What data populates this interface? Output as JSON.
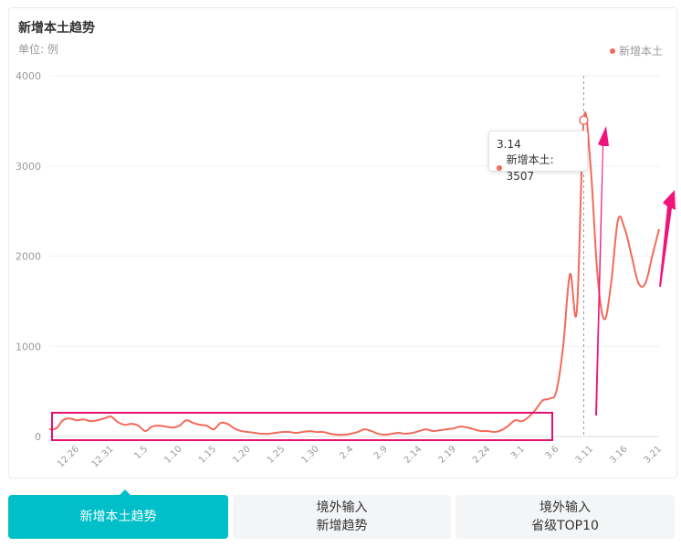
{
  "card": {
    "title": "新增本土趋势",
    "unit": "单位: 例",
    "legend_label": "新增本土"
  },
  "tooltip": {
    "date": "3.14",
    "label": "新增本土: 3507"
  },
  "colors": {
    "series": "#f26b5b",
    "highlight_box": "#e4126f",
    "arrow": "#f0137a",
    "tab_active": "#00bfc8",
    "tab_inactive": "#f4f5f7"
  },
  "tabs": [
    {
      "line1": "新增本土趋势",
      "line2": "",
      "active": true
    },
    {
      "line1": "境外输入",
      "line2": "新增趋势",
      "active": false
    },
    {
      "line1": "境外输入",
      "line2": "省级TOP10",
      "active": false
    }
  ],
  "chart_data": {
    "type": "line",
    "ylim": [
      0,
      4000
    ],
    "yticks": [
      0,
      1000,
      2000,
      3000,
      4000
    ],
    "ytick_labels": [
      "0",
      "1000",
      "2000",
      "3000",
      "4000"
    ],
    "xtick_labels": [
      "12.26",
      "12.31",
      "1.5",
      "1.10",
      "1.15",
      "1.20",
      "1.25",
      "1.30",
      "2.4",
      "2.9",
      "2.14",
      "2.19",
      "2.24",
      "3.1",
      "3.6",
      "3.11",
      "3.16",
      "3.21"
    ],
    "grid": true,
    "legend_position": "top-right",
    "highlight_index": 78,
    "series": [
      {
        "name": "新增本土",
        "values": [
          80,
          90,
          180,
          200,
          180,
          190,
          170,
          180,
          200,
          220,
          160,
          130,
          140,
          120,
          60,
          110,
          120,
          110,
          100,
          120,
          180,
          150,
          130,
          120,
          80,
          150,
          140,
          90,
          60,
          50,
          40,
          30,
          30,
          40,
          50,
          50,
          40,
          50,
          60,
          50,
          50,
          30,
          20,
          20,
          30,
          50,
          80,
          60,
          30,
          20,
          30,
          40,
          30,
          40,
          60,
          80,
          60,
          70,
          80,
          90,
          110,
          100,
          80,
          60,
          60,
          50,
          70,
          120,
          180,
          170,
          220,
          300,
          400,
          420,
          500,
          1000,
          1800,
          1400,
          3507,
          3000,
          1800,
          1300,
          1700,
          2400,
          2300,
          2000,
          1700,
          1700,
          2000,
          2300
        ]
      }
    ]
  }
}
